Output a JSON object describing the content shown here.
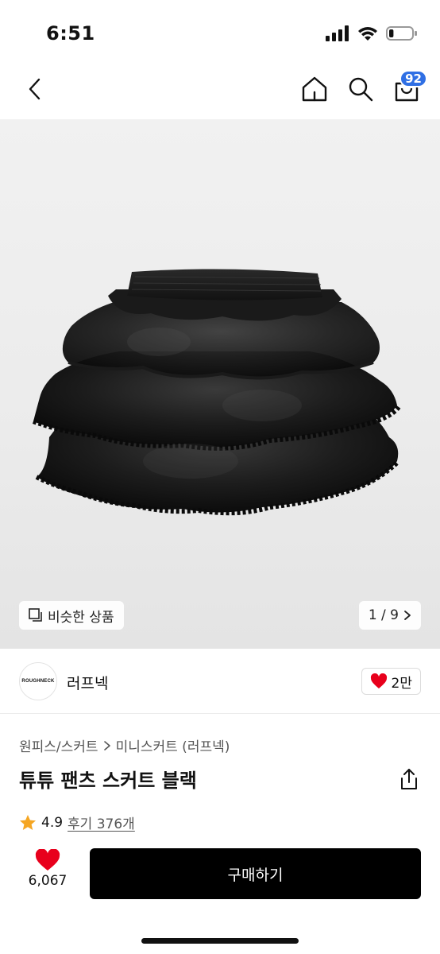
{
  "status_bar": {
    "time": "6:51",
    "battery_level": 0.2
  },
  "nav": {
    "cart_badge": "92"
  },
  "gallery": {
    "similar_label": "비슷한 상품",
    "page_indicator": "1 / 9"
  },
  "brand": {
    "logo_text": "ROUGHNECK",
    "name": "러프넥",
    "likes": "2만"
  },
  "product": {
    "breadcrumb": [
      "원피스/스커트",
      "미니스커트 (러프넥)"
    ],
    "title": "튜튜 팬츠 스커트 블랙",
    "rating": "4.9",
    "reviews": "후기 376개"
  },
  "bottom": {
    "wish_count": "6,067",
    "buy_label": "구매하기"
  },
  "colors": {
    "accent_blue": "#2f6fe4",
    "heart_red": "#e8001c",
    "star_orange": "#f5a623",
    "buy_black": "#000000"
  }
}
